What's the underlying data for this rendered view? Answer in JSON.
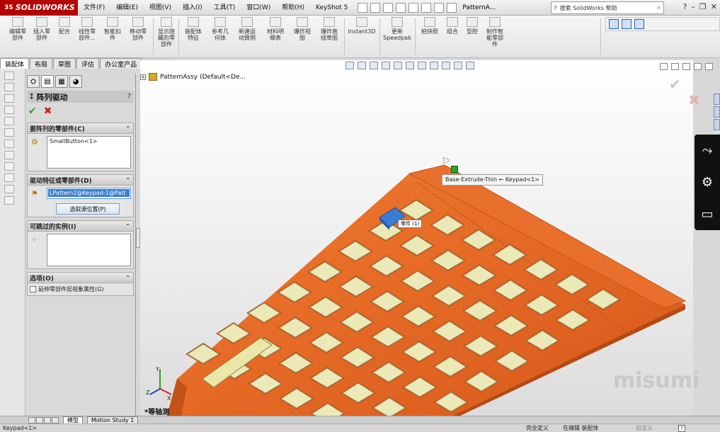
{
  "app": {
    "brand": "SOLIDWORKS",
    "brand_prefix": "3S",
    "doc_title": "PatternA...",
    "search_placeholder": "搜索 SolidWorks 帮助"
  },
  "menu": [
    "文件(F)",
    "编辑(E)",
    "视图(V)",
    "插入(I)",
    "工具(T)",
    "窗口(W)",
    "帮助(H)",
    "KeyShot 5"
  ],
  "ribbon": {
    "items": [
      {
        "label": "编辑零\n部件"
      },
      {
        "label": "插入零\n部件"
      },
      {
        "label": "配合"
      },
      {
        "label": "线性零\n部件..."
      },
      {
        "label": "智能扣\n件"
      },
      {
        "label": "移动零\n部件"
      },
      {
        "label": "显示隐\n藏的零\n部件"
      },
      {
        "label": "装配体\n特征"
      },
      {
        "label": "参考几\n何体"
      },
      {
        "label": "新建运\n动算例"
      },
      {
        "label": "材料明\n细表"
      },
      {
        "label": "爆炸视\n图"
      },
      {
        "label": "爆炸直\n线草图"
      },
      {
        "label": "Instant3D"
      },
      {
        "label": "更新\nSpeedpak"
      },
      {
        "label": "拍快照"
      },
      {
        "label": "组合"
      },
      {
        "label": "型腔"
      },
      {
        "label": "制作智\n能零部\n件"
      }
    ]
  },
  "tabs": [
    "装配体",
    "布局",
    "草图",
    "评估",
    "办公室产品"
  ],
  "property_manager": {
    "title": "阵列驱动",
    "help": "?",
    "ok_glyph": "✔",
    "cancel_glyph": "✖",
    "groups": {
      "components": {
        "title": "要阵列的零部件(C)",
        "value": "SmallButton<1>"
      },
      "driving": {
        "title": "驱动特征或零部件(D)",
        "value": "LPattern2@Keypad-1@Patt",
        "button": "选取源位置(P)"
      },
      "skipped": {
        "title": "可跳过的实例(I)"
      },
      "options": {
        "title": "选项(O)",
        "checkbox": "延伸零部件层视象属性(G)"
      }
    }
  },
  "viewport": {
    "tree_root": "PatternAssy  (Default<De...",
    "tooltip": "Base-Extrude-Thin ← Keypad<1>",
    "tag": "零件 (1)",
    "view_orientation": "*等轴测",
    "watermark": "misumi",
    "triad_x": "X",
    "triad_y": "Y",
    "triad_z": "Z"
  },
  "bottom_tabs": [
    "模型",
    "Motion Study 1"
  ],
  "status": {
    "left": "Keypad<1>",
    "defined": "完全定义",
    "editing": "在编辑 装配体",
    "custom": "自定义",
    "help": "?"
  },
  "colors": {
    "keypad_orange": "#e56a24",
    "key_yellow": "#ece9b8",
    "selected_button": "#3a7bd5",
    "brand_red": "#b30000"
  }
}
